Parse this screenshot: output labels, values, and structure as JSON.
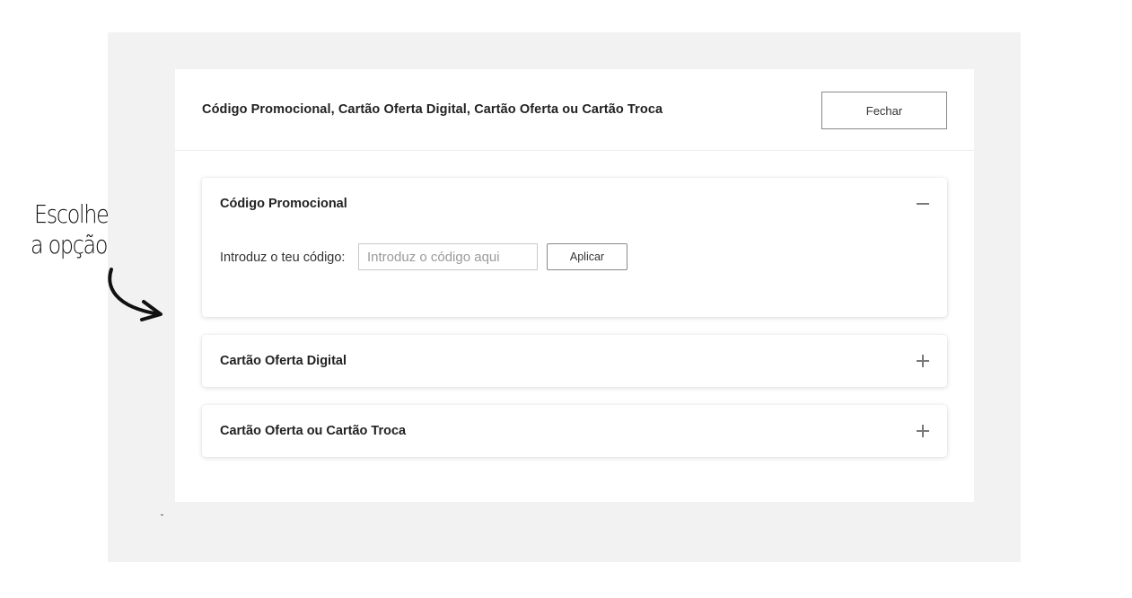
{
  "modal": {
    "title": "Código Promocional, Cartão Oferta Digital, Cartão Oferta ou Cartão Troca",
    "close_label": "Fechar"
  },
  "panels": [
    {
      "title": "Código Promocional",
      "expanded": true,
      "toggle_icon": "minus-icon",
      "code_label": "Introduz o teu código:",
      "input_placeholder": "Introduz o código aqui",
      "input_value": "",
      "apply_label": "Aplicar"
    },
    {
      "title": "Cartão Oferta Digital",
      "expanded": false,
      "toggle_icon": "plus-icon"
    },
    {
      "title": "Cartão Oferta ou Cartão Troca",
      "expanded": false,
      "toggle_icon": "plus-icon"
    }
  ],
  "annotation": {
    "line1": "Escolhe",
    "line2": "a opção",
    "arrow_icon": "curved-arrow-icon"
  },
  "colors": {
    "backdrop": "#f2f2f2",
    "surface": "#ffffff",
    "text": "#222222",
    "icon": "#7a7a7a"
  }
}
